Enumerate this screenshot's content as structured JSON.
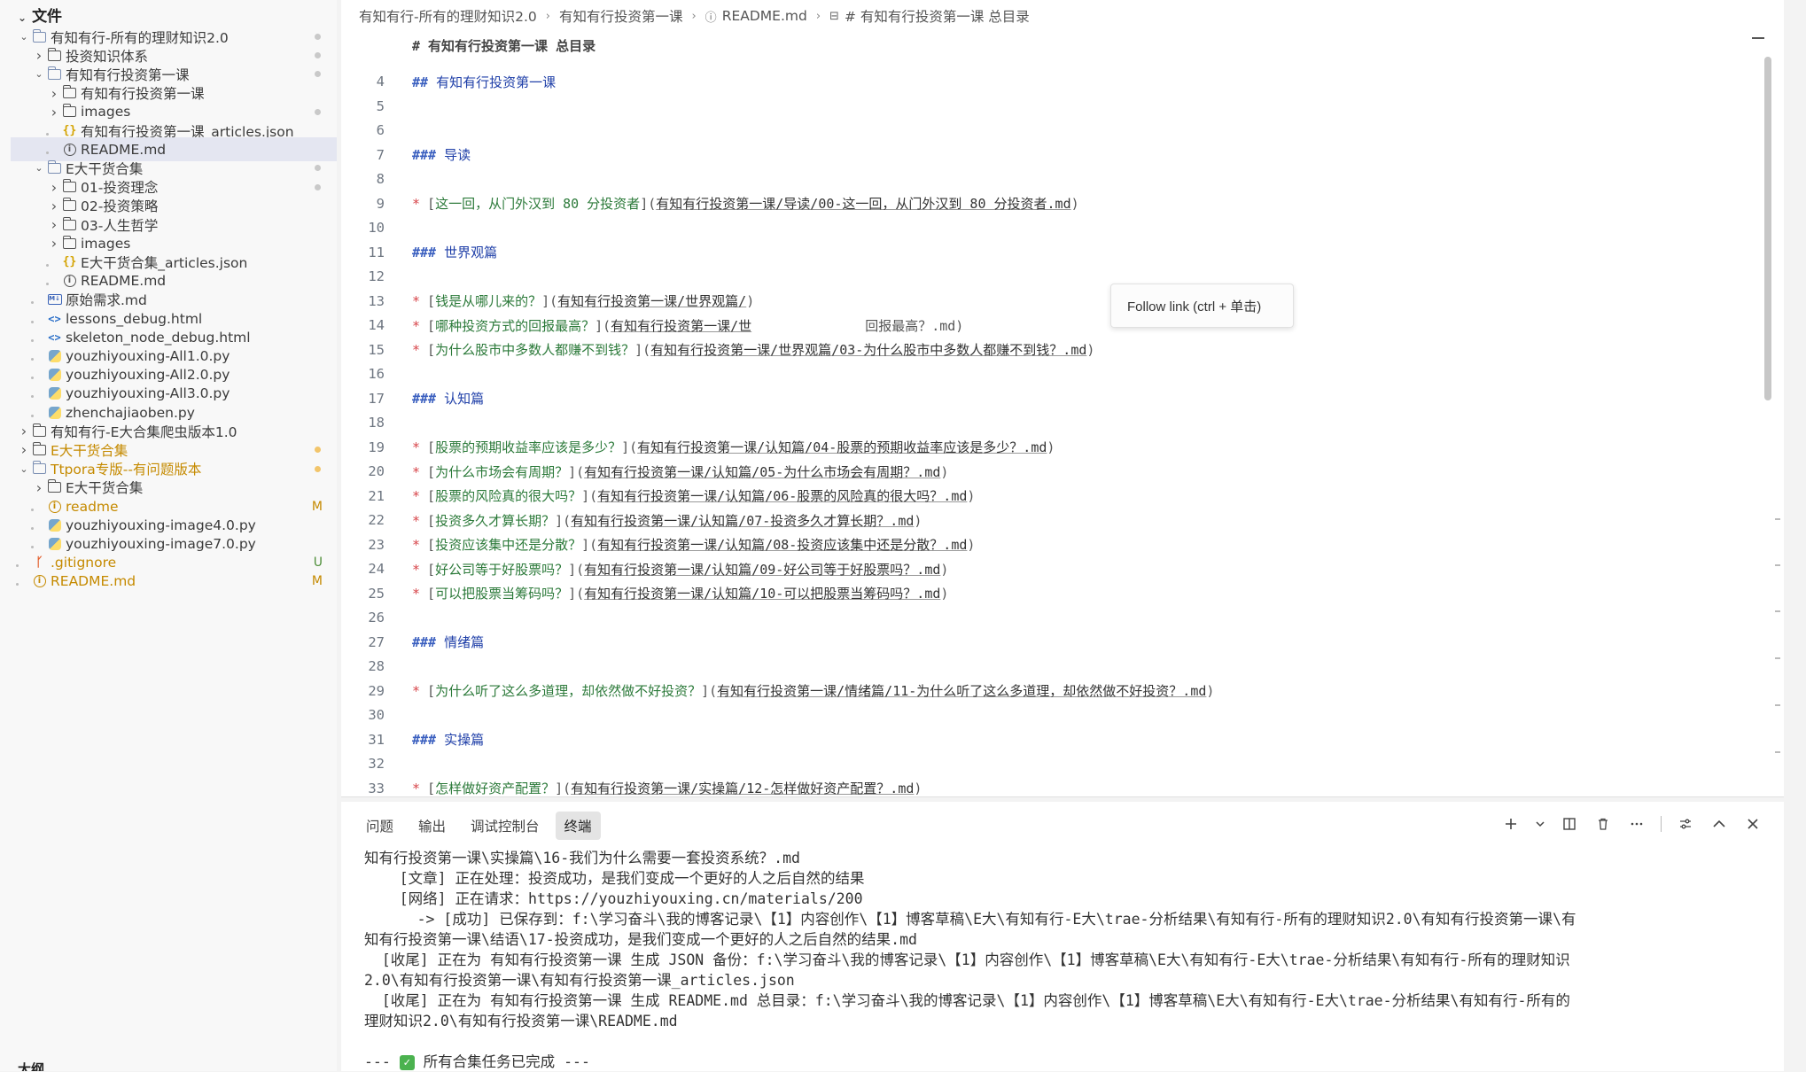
{
  "sidebar": {
    "title": "文件",
    "outline_title": "大纲",
    "items": [
      {
        "label": "有知有行-所有的理财知识2.0",
        "badge": "",
        "dot": "gray"
      },
      {
        "label": "投资知识体系",
        "badge": "",
        "dot": "gray"
      },
      {
        "label": "有知有行投资第一课",
        "badge": "",
        "dot": "gray"
      },
      {
        "label": "有知有行投资第一课",
        "badge": "",
        "dot": ""
      },
      {
        "label": "images",
        "badge": "",
        "dot": "gray"
      },
      {
        "label": "有知有行投资第一课_articles.json",
        "badge": "",
        "dot": ""
      },
      {
        "label": "README.md",
        "badge": "",
        "dot": ""
      },
      {
        "label": "E大干货合集",
        "badge": "",
        "dot": "gray"
      },
      {
        "label": "01-投资理念",
        "badge": "",
        "dot": "gray"
      },
      {
        "label": "02-投资策略",
        "badge": "",
        "dot": ""
      },
      {
        "label": "03-人生哲学",
        "badge": "",
        "dot": ""
      },
      {
        "label": "images",
        "badge": "",
        "dot": ""
      },
      {
        "label": "E大干货合集_articles.json",
        "badge": "",
        "dot": ""
      },
      {
        "label": "README.md",
        "badge": "",
        "dot": ""
      },
      {
        "label": "原始需求.md",
        "badge": "",
        "dot": ""
      },
      {
        "label": "lessons_debug.html",
        "badge": "",
        "dot": ""
      },
      {
        "label": "skeleton_node_debug.html",
        "badge": "",
        "dot": ""
      },
      {
        "label": "youzhiyouxing-All1.0.py",
        "badge": "",
        "dot": ""
      },
      {
        "label": "youzhiyouxing-All2.0.py",
        "badge": "",
        "dot": ""
      },
      {
        "label": "youzhiyouxing-All3.0.py",
        "badge": "",
        "dot": ""
      },
      {
        "label": "zhenchajiaoben.py",
        "badge": "",
        "dot": ""
      },
      {
        "label": "有知有行-E大合集爬虫版本1.0",
        "badge": "",
        "dot": ""
      },
      {
        "label": "E大干货合集",
        "badge": "",
        "dot": "orange"
      },
      {
        "label": "Ttpora专版--有问题版本",
        "badge": "",
        "dot": "orange"
      },
      {
        "label": "E大干货合集",
        "badge": "",
        "dot": ""
      },
      {
        "label": "readme",
        "badge": "M",
        "dot": ""
      },
      {
        "label": "youzhiyouxing-image4.0.py",
        "badge": "",
        "dot": ""
      },
      {
        "label": "youzhiyouxing-image7.0.py",
        "badge": "",
        "dot": ""
      },
      {
        "label": ".gitignore",
        "badge": "U",
        "dot": ""
      },
      {
        "label": "README.md",
        "badge": "M",
        "dot": ""
      }
    ]
  },
  "breadcrumb": [
    "有知有行-所有的理财知识2.0",
    "有知有行投资第一课",
    "README.md",
    "# 有知有行投资第一课 总目录"
  ],
  "editor": {
    "sticky_heading": "# 有知有行投资第一课 总目录",
    "lines": [
      {
        "n": "4",
        "kind": "h",
        "marker": "##",
        "text": "有知有行投资第一课"
      },
      {
        "n": "5",
        "kind": "blank"
      },
      {
        "n": "6",
        "kind": "blank"
      },
      {
        "n": "7",
        "kind": "h",
        "marker": "###",
        "text": "导读"
      },
      {
        "n": "8",
        "kind": "blank"
      },
      {
        "n": "9",
        "kind": "link",
        "title": "这一回，从门外汉到 80 分投资者",
        "url": "有知有行投资第一课/导读/00-这一回，从门外汉到 80 分投资者.md"
      },
      {
        "n": "10",
        "kind": "blank"
      },
      {
        "n": "11",
        "kind": "h",
        "marker": "###",
        "text": "世界观篇"
      },
      {
        "n": "12",
        "kind": "blank"
      },
      {
        "n": "13",
        "kind": "link",
        "title": "钱是从哪儿来的？",
        "url": "有知有行投资第一课/世界观篇/"
      },
      {
        "n": "14",
        "kind": "link",
        "title": "哪种投资方式的回报最高？",
        "url": "有知有行投资第一课/世",
        "tail": "回报最高？.md)"
      },
      {
        "n": "15",
        "kind": "link",
        "title": "为什么股市中多数人都赚不到钱？",
        "url": "有知有行投资第一课/世界观篇/03-为什么股市中多数人都赚不到钱？.md"
      },
      {
        "n": "16",
        "kind": "blank"
      },
      {
        "n": "17",
        "kind": "h",
        "marker": "###",
        "text": "认知篇"
      },
      {
        "n": "18",
        "kind": "blank"
      },
      {
        "n": "19",
        "kind": "link",
        "title": "股票的预期收益率应该是多少？",
        "url": "有知有行投资第一课/认知篇/04-股票的预期收益率应该是多少？.md"
      },
      {
        "n": "20",
        "kind": "link",
        "title": "为什么市场会有周期？",
        "url": "有知有行投资第一课/认知篇/05-为什么市场会有周期？.md"
      },
      {
        "n": "21",
        "kind": "link",
        "title": "股票的风险真的很大吗？",
        "url": "有知有行投资第一课/认知篇/06-股票的风险真的很大吗？.md"
      },
      {
        "n": "22",
        "kind": "link",
        "title": "投资多久才算长期？",
        "url": "有知有行投资第一课/认知篇/07-投资多久才算长期？.md"
      },
      {
        "n": "23",
        "kind": "link",
        "title": "投资应该集中还是分散？",
        "url": "有知有行投资第一课/认知篇/08-投资应该集中还是分散？.md"
      },
      {
        "n": "24",
        "kind": "link",
        "title": "好公司等于好股票吗？",
        "url": "有知有行投资第一课/认知篇/09-好公司等于好股票吗？.md"
      },
      {
        "n": "25",
        "kind": "link",
        "title": "可以把股票当筹码吗？",
        "url": "有知有行投资第一课/认知篇/10-可以把股票当筹码吗？.md"
      },
      {
        "n": "26",
        "kind": "blank"
      },
      {
        "n": "27",
        "kind": "h",
        "marker": "###",
        "text": "情绪篇"
      },
      {
        "n": "28",
        "kind": "blank"
      },
      {
        "n": "29",
        "kind": "link",
        "title": "为什么听了这么多道理，却依然做不好投资？",
        "url": "有知有行投资第一课/情绪篇/11-为什么听了这么多道理，却依然做不好投资？.md"
      },
      {
        "n": "30",
        "kind": "blank"
      },
      {
        "n": "31",
        "kind": "h",
        "marker": "###",
        "text": "实操篇"
      },
      {
        "n": "32",
        "kind": "blank"
      },
      {
        "n": "33",
        "kind": "link",
        "title": "怎样做好资产配置？",
        "url": "有知有行投资第一课/实操篇/12-怎样做好资产配置？.md"
      }
    ]
  },
  "tooltip": "Follow link (ctrl + 单击)",
  "panel": {
    "tabs": [
      "问题",
      "输出",
      "调试控制台",
      "终端"
    ],
    "active_tab": "终端",
    "actions": [
      "add-icon",
      "chevron-down-icon",
      "split-icon",
      "trash-icon",
      "more-icon",
      "settings-icon",
      "maximize-icon",
      "close-icon"
    ],
    "terminal_lines": [
      "知有行投资第一课\\实操篇\\16-我们为什么需要一套投资系统？.md",
      "    [文章] 正在处理：投资成功，是我们变成一个更好的人之后自然的结果",
      "    [网络] 正在请求：https://youzhiyouxing.cn/materials/200",
      "      -> [成功] 已保存到：f:\\学习奋斗\\我的博客记录\\【1】内容创作\\【1】博客草稿\\E大\\有知有行-E大\\trae-分析结果\\有知有行-所有的理财知识2.0\\有知有行投资第一课\\有",
      "知有行投资第一课\\结语\\17-投资成功，是我们变成一个更好的人之后自然的结果.md",
      "  [收尾] 正在为 有知有行投资第一课 生成 JSON 备份：f:\\学习奋斗\\我的博客记录\\【1】内容创作\\【1】博客草稿\\E大\\有知有行-E大\\trae-分析结果\\有知有行-所有的理财知识",
      "2.0\\有知有行投资第一课\\有知有行投资第一课_articles.json",
      "  [收尾] 正在为 有知有行投资第一课 生成 README.md 总目录：f:\\学习奋斗\\我的博客记录\\【1】内容创作\\【1】博客草稿\\E大\\有知有行-E大\\trae-分析结果\\有知有行-所有的",
      "理财知识2.0\\有知有行投资第一课\\README.md",
      "",
      "--- ✅ 所有合集任务已完成 ---"
    ]
  },
  "colors": {
    "accent": "#3a5fbf",
    "link_title": "#2c7a3a",
    "bullet": "#d7454a",
    "modified": "#c58a00",
    "untracked": "#4f8f3a"
  }
}
